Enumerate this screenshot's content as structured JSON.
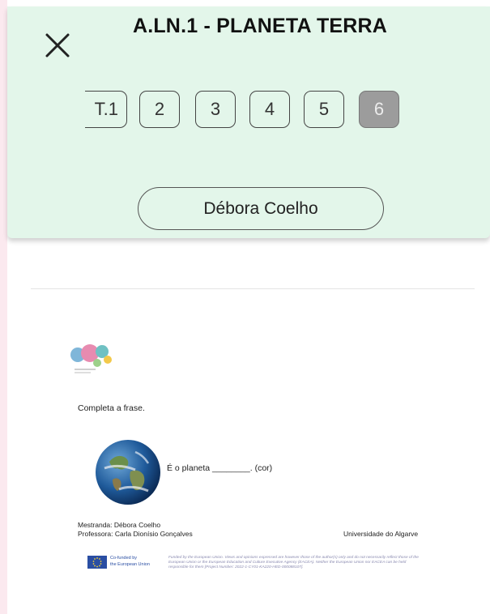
{
  "header": {
    "title": "A.LN.1 - PLANETA TERRA",
    "pages": [
      "T.1",
      "2",
      "3",
      "4",
      "5",
      "6"
    ],
    "active_page": "6",
    "student_name": "Débora Coelho"
  },
  "document": {
    "instruction": "Completa a frase.",
    "sentence": "É o planeta ________. (cor)",
    "student_line": "Mestranda: Débora Coelho",
    "teacher_line": "Professora: Carla Dionísio Gonçalves",
    "university": "Universidade do Algarve",
    "eu_logo_text_1": "Co-funded by",
    "eu_logo_text_2": "the European Union",
    "disclaimer": "Funded by the European Union. Views and opinions expressed are however those of the author(s) only and do not necessarily reflect those of the European Union or the European Education and Culture Executive Agency (EACEA). Neither the European Union nor EACEA can be held responsible for them [Project Number: 2022-1-CY01-KA220-HED-000088107]."
  },
  "colors": {
    "header_bg": "#e3f6ea",
    "active_page_bg": "#9c9c9c",
    "side_bg": "#fbe9ef"
  },
  "icons": {
    "close": "close-icon"
  }
}
